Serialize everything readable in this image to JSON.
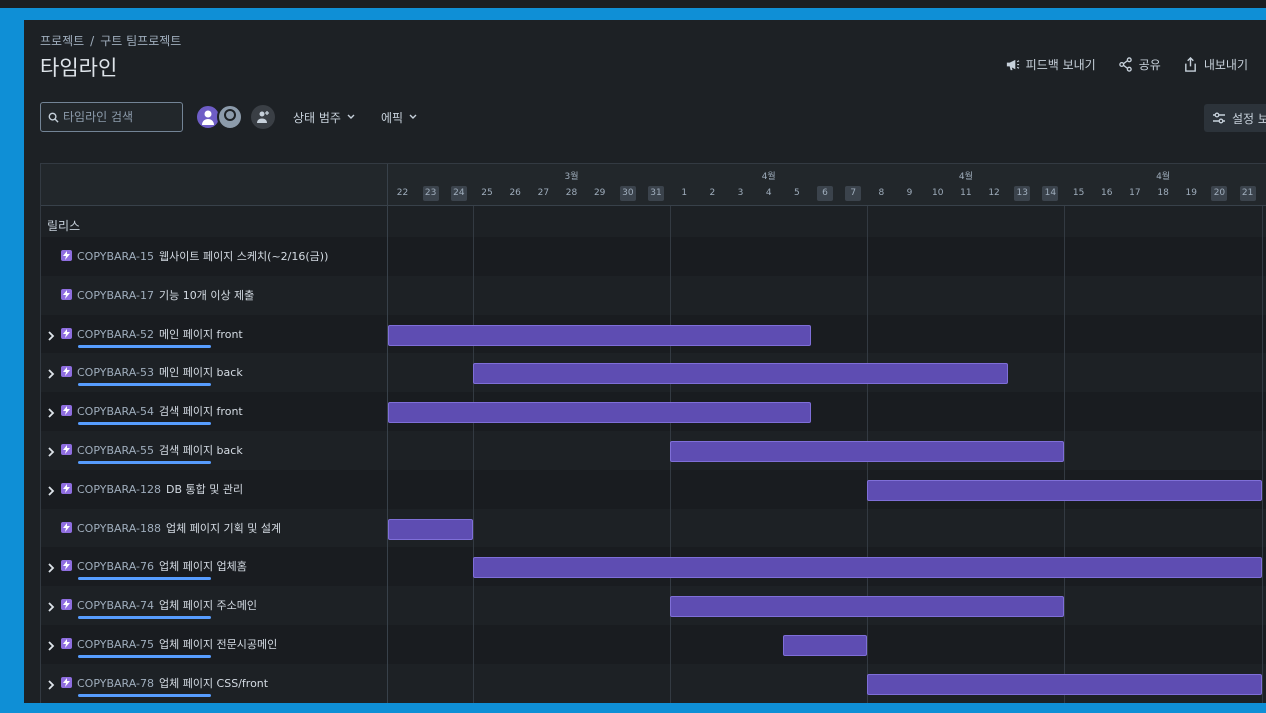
{
  "breadcrumb": [
    "프로젝트",
    "구트 팀프로젝트"
  ],
  "title": "타임라인",
  "header_actions": [
    {
      "label": "피드백 보내기",
      "icon": "megaphone-icon"
    },
    {
      "label": "공유",
      "icon": "share-icon"
    },
    {
      "label": "내보내기",
      "icon": "export-icon"
    }
  ],
  "search": {
    "placeholder": "타임라인 검색",
    "value": ""
  },
  "filters": {
    "status": "상태 범주",
    "epic": "에픽"
  },
  "settings_label": "설정 보",
  "release_label": "릴리스",
  "months": [
    {
      "label": "3월",
      "day_index": 6
    },
    {
      "label": "4월",
      "day_index": 13
    },
    {
      "label": "4월",
      "day_index": 20
    },
    {
      "label": "4월",
      "day_index": 27
    }
  ],
  "days": [
    "22",
    "23",
    "24",
    "25",
    "26",
    "27",
    "28",
    "29",
    "30",
    "31",
    "1",
    "2",
    "3",
    "4",
    "5",
    "6",
    "7",
    "8",
    "9",
    "10",
    "11",
    "12",
    "13",
    "14",
    "15",
    "16",
    "17",
    "18",
    "19",
    "20",
    "21"
  ],
  "weekend_indices": [
    1,
    2,
    8,
    9,
    15,
    16,
    22,
    23,
    29,
    30
  ],
  "issues": [
    {
      "key": "COPYBARA-15",
      "title": "웹사이트 페이지 스케치(~2/16(금))",
      "expandable": false,
      "progress": false,
      "bar": null
    },
    {
      "key": "COPYBARA-17",
      "title": "기능 10개 이상 제출",
      "expandable": false,
      "progress": false,
      "bar": null
    },
    {
      "key": "COPYBARA-52",
      "title": "메인 페이지 front",
      "expandable": true,
      "progress": true,
      "bar": {
        "start": "22",
        "end": "5"
      }
    },
    {
      "key": "COPYBARA-53",
      "title": "메인 페이지 back",
      "expandable": true,
      "progress": true,
      "bar": {
        "start": "25",
        "end": "12"
      }
    },
    {
      "key": "COPYBARA-54",
      "title": "검색 페이지 front",
      "expandable": true,
      "progress": true,
      "bar": {
        "start": "22",
        "end": "5"
      }
    },
    {
      "key": "COPYBARA-55",
      "title": "검색 페이지 back",
      "expandable": true,
      "progress": true,
      "bar": {
        "start": "1",
        "end": "14"
      }
    },
    {
      "key": "COPYBARA-128",
      "title": "DB 통합 및 관리",
      "expandable": true,
      "progress": false,
      "bar": {
        "start": "8",
        "end": "21"
      }
    },
    {
      "key": "COPYBARA-188",
      "title": "업체 페이지 기획 및 설계",
      "expandable": false,
      "progress": false,
      "bar": {
        "start": "22",
        "end": "24"
      }
    },
    {
      "key": "COPYBARA-76",
      "title": "업체 페이지 업체홈",
      "expandable": true,
      "progress": true,
      "bar": {
        "start": "25",
        "end": "21"
      }
    },
    {
      "key": "COPYBARA-74",
      "title": "업체 페이지 주소메인",
      "expandable": true,
      "progress": true,
      "bar": {
        "start": "1",
        "end": "14"
      }
    },
    {
      "key": "COPYBARA-75",
      "title": "업체 페이지 전문시공메인",
      "expandable": true,
      "progress": true,
      "bar": {
        "start": "5",
        "end": "7"
      }
    },
    {
      "key": "COPYBARA-78",
      "title": "업체 페이지 CSS/front",
      "expandable": true,
      "progress": true,
      "bar": {
        "start": "8",
        "end": "21"
      }
    }
  ]
}
